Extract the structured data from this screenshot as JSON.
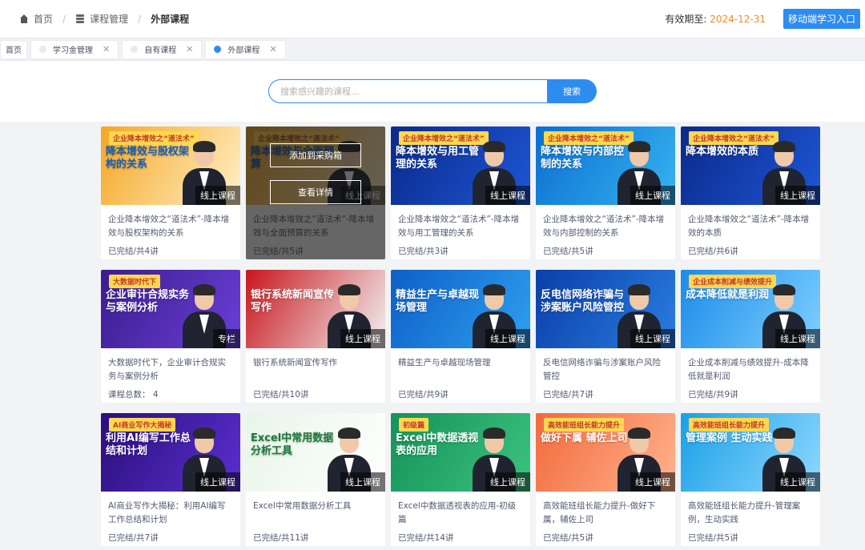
{
  "breadcrumb": {
    "home": "首页",
    "course_mgmt": "课程管理",
    "current": "外部课程"
  },
  "header": {
    "validity_label": "有效期至:",
    "validity_date": "2024-12-31",
    "mobile_button": "移动端学习入口"
  },
  "tabs": [
    {
      "label": "首页",
      "closable": false,
      "active": false
    },
    {
      "label": "学习金管理",
      "closable": true,
      "active": false
    },
    {
      "label": "自有课程",
      "closable": true,
      "active": false
    },
    {
      "label": "外部课程",
      "closable": true,
      "active": true
    }
  ],
  "search": {
    "placeholder": "搜索感兴趣的课程...",
    "button": "搜索"
  },
  "overlay": {
    "add_label": "添加到采购箱",
    "detail_label": "查看详情"
  },
  "courses": [
    {
      "title": "企业降本增效之“道法术”-降本增效与股权架构的关系",
      "meta": "已完结/共4讲",
      "badge": "线上课程",
      "thumb_text": "降本增效与股权架构的关系",
      "tag": "企业降本增效之“道法术”",
      "bg": "#f5a623",
      "bg2": "#fff1c9",
      "text_color": "#1a5fb4"
    },
    {
      "title": "企业降本增效之“道法术”-降本增效与全面预算的关系",
      "meta": "已完结/共5讲",
      "badge": "线上课程",
      "thumb_text": "降本增效与全面预算",
      "tag": "企业降本增效之“道法术”",
      "bg": "#f5a623",
      "bg2": "#fff1c9",
      "text_color": "#1a5fb4"
    },
    {
      "title": "企业降本增效之“道法术”-降本增效与用工管理的关系",
      "meta": "已完结/共3讲",
      "badge": "线上课程",
      "thumb_text": "降本增效与用工管理的关系",
      "tag": "企业降本增效之“道法术”",
      "bg": "#0a2a8a",
      "bg2": "#1e56d6",
      "text_color": "#ffffff"
    },
    {
      "title": "企业降本增效之“道法术”-降本增效与内部控制的关系",
      "meta": "已完结/共5讲",
      "badge": "线上课程",
      "thumb_text": "降本增效与内部控制的关系",
      "tag": "企业降本增效之“道法术”",
      "bg": "#0b6fd1",
      "bg2": "#36b3f0",
      "text_color": "#ffffff"
    },
    {
      "title": "企业降本增效之“道法术”-降本增效的本质",
      "meta": "已完结/共6讲",
      "badge": "线上课程",
      "thumb_text": "降本增效的本质",
      "tag": "企业降本增效之“道法术”",
      "bg": "#0a2a8a",
      "bg2": "#1e56d6",
      "text_color": "#ffffff"
    },
    {
      "title": "大数据时代下，企业审计合规实务与案例分析",
      "meta": "课程总数： 4",
      "badge": "专栏",
      "thumb_text": "企业审计合规实务与案例分析",
      "tag": "大数据时代下",
      "bg": "#3b1d8f",
      "bg2": "#6a3fd6",
      "text_color": "#ffffff"
    },
    {
      "title": "银行系统新闻宣传写作",
      "meta": "已完结/共10讲",
      "badge": "线上课程",
      "thumb_text": "银行系统新闻宣传写作",
      "tag": "",
      "bg": "#c8161d",
      "bg2": "#f2f2f2",
      "text_color": "#ffffff"
    },
    {
      "title": "精益生产与卓越现场管理",
      "meta": "已完结/共9讲",
      "badge": "线上课程",
      "thumb_text": "精益生产与卓越现场管理",
      "tag": "",
      "bg": "#0d5fc8",
      "bg2": "#2fa0ee",
      "text_color": "#ffffff"
    },
    {
      "title": "反电信网络诈骗与涉案账户风险管控",
      "meta": "已完结/共7讲",
      "badge": "线上课程",
      "thumb_text": "反电信网络诈骗与涉案账户风险管控",
      "tag": "",
      "bg": "#0a3fa8",
      "bg2": "#2a7de0",
      "text_color": "#ffffff"
    },
    {
      "title": "企业成本削减与绩效提升-成本降低就是利润",
      "meta": "已完结/共9讲",
      "badge": "线上课程",
      "thumb_text": "成本降低就是利润",
      "tag": "企业成本削减与绩效提升",
      "bg": "#1b8be8",
      "bg2": "#7fd0ff",
      "text_color": "#ffffff"
    },
    {
      "title": "AI商业写作大揭秘：利用AI编写工作总结和计划",
      "meta": "已完结/共7讲",
      "badge": "线上课程",
      "thumb_text": "利用AI编写工作总结和计划",
      "tag": "AI商业写作大揭秘",
      "bg": "#2b0f7a",
      "bg2": "#5a2fd0",
      "text_color": "#ffffff"
    },
    {
      "title": "Excel中常用数据分析工具",
      "meta": "已完结/共11讲",
      "badge": "线上课程",
      "thumb_text": "Excel中常用数据分析工具",
      "tag": "",
      "bg": "#e8f5e9",
      "bg2": "#ffffff",
      "text_color": "#1b7a3a"
    },
    {
      "title": "Excel中数据透视表的应用-初级篇",
      "meta": "已完结/共14讲",
      "badge": "线上课程",
      "thumb_text": "Excel中数据透视表的应用",
      "tag": "初级篇",
      "bg": "#15925a",
      "bg2": "#3cc37f",
      "text_color": "#ffffff"
    },
    {
      "title": "高效能班组长能力提升-做好下属，辅佐上司",
      "meta": "已完结/共5讲",
      "badge": "线上课程",
      "thumb_text": "做好下属 辅佐上司",
      "tag": "高效能班组长能力提升",
      "bg": "#f26a3b",
      "bg2": "#ffb38f",
      "text_color": "#ffffff"
    },
    {
      "title": "高效能班组长能力提升-管理案例，生动实践",
      "meta": "已完结/共5讲",
      "badge": "线上课程",
      "thumb_text": "管理案例 生动实践",
      "tag": "高效能班组长能力提升",
      "bg": "#1aa0e6",
      "bg2": "#8fd8ff",
      "text_color": "#ffffff"
    }
  ],
  "hovered_card_index": 1
}
